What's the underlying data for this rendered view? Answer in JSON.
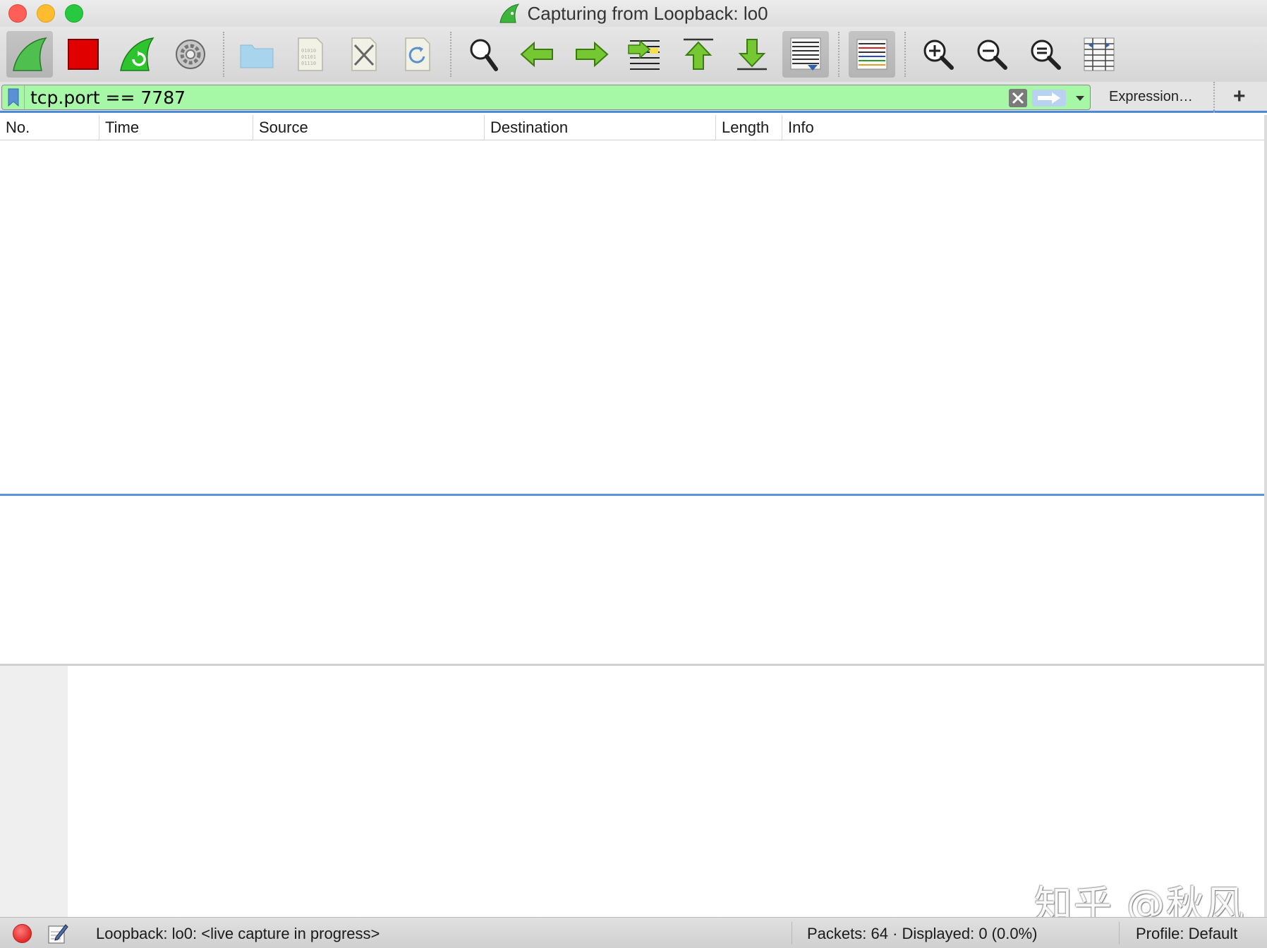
{
  "window": {
    "title": "Capturing from Loopback: lo0"
  },
  "toolbar": {
    "buttons": [
      {
        "icon": "shark-fin-start-icon",
        "active": true
      },
      {
        "icon": "stop-square-icon"
      },
      {
        "icon": "restart-capture-icon"
      },
      {
        "icon": "capture-options-gear-icon"
      },
      {
        "icon": "open-folder-icon"
      },
      {
        "icon": "save-file-icon"
      },
      {
        "icon": "close-file-icon"
      },
      {
        "icon": "reload-file-icon"
      },
      {
        "icon": "find-magnifier-icon"
      },
      {
        "icon": "go-back-arrow-icon"
      },
      {
        "icon": "go-forward-arrow-icon"
      },
      {
        "icon": "go-to-packet-icon"
      },
      {
        "icon": "first-packet-icon"
      },
      {
        "icon": "last-packet-icon"
      },
      {
        "icon": "autoscroll-icon",
        "active": true
      },
      {
        "icon": "colorize-icon",
        "active": true
      },
      {
        "icon": "zoom-in-icon"
      },
      {
        "icon": "zoom-out-icon"
      },
      {
        "icon": "normal-size-icon"
      },
      {
        "icon": "resize-columns-icon"
      }
    ]
  },
  "filter": {
    "value": "tcp.port == 7787",
    "valid_color": "#a6f7a6",
    "expression_label": "Expression…",
    "add_label": "+"
  },
  "packet_list": {
    "columns": [
      "No.",
      "Time",
      "Source",
      "Destination",
      "Length",
      "Info"
    ],
    "rows": []
  },
  "watermark": "知乎 @秋风",
  "status": {
    "capture_text": "Loopback: lo0: <live capture in progress>",
    "packets_text": "Packets: 64 · Displayed: 0 (0.0%)",
    "profile_text": "Profile: Default"
  },
  "colors": {
    "accent": "#4a8ad8",
    "stop_red": "#e00000",
    "shark_green": "#3cb53c"
  }
}
